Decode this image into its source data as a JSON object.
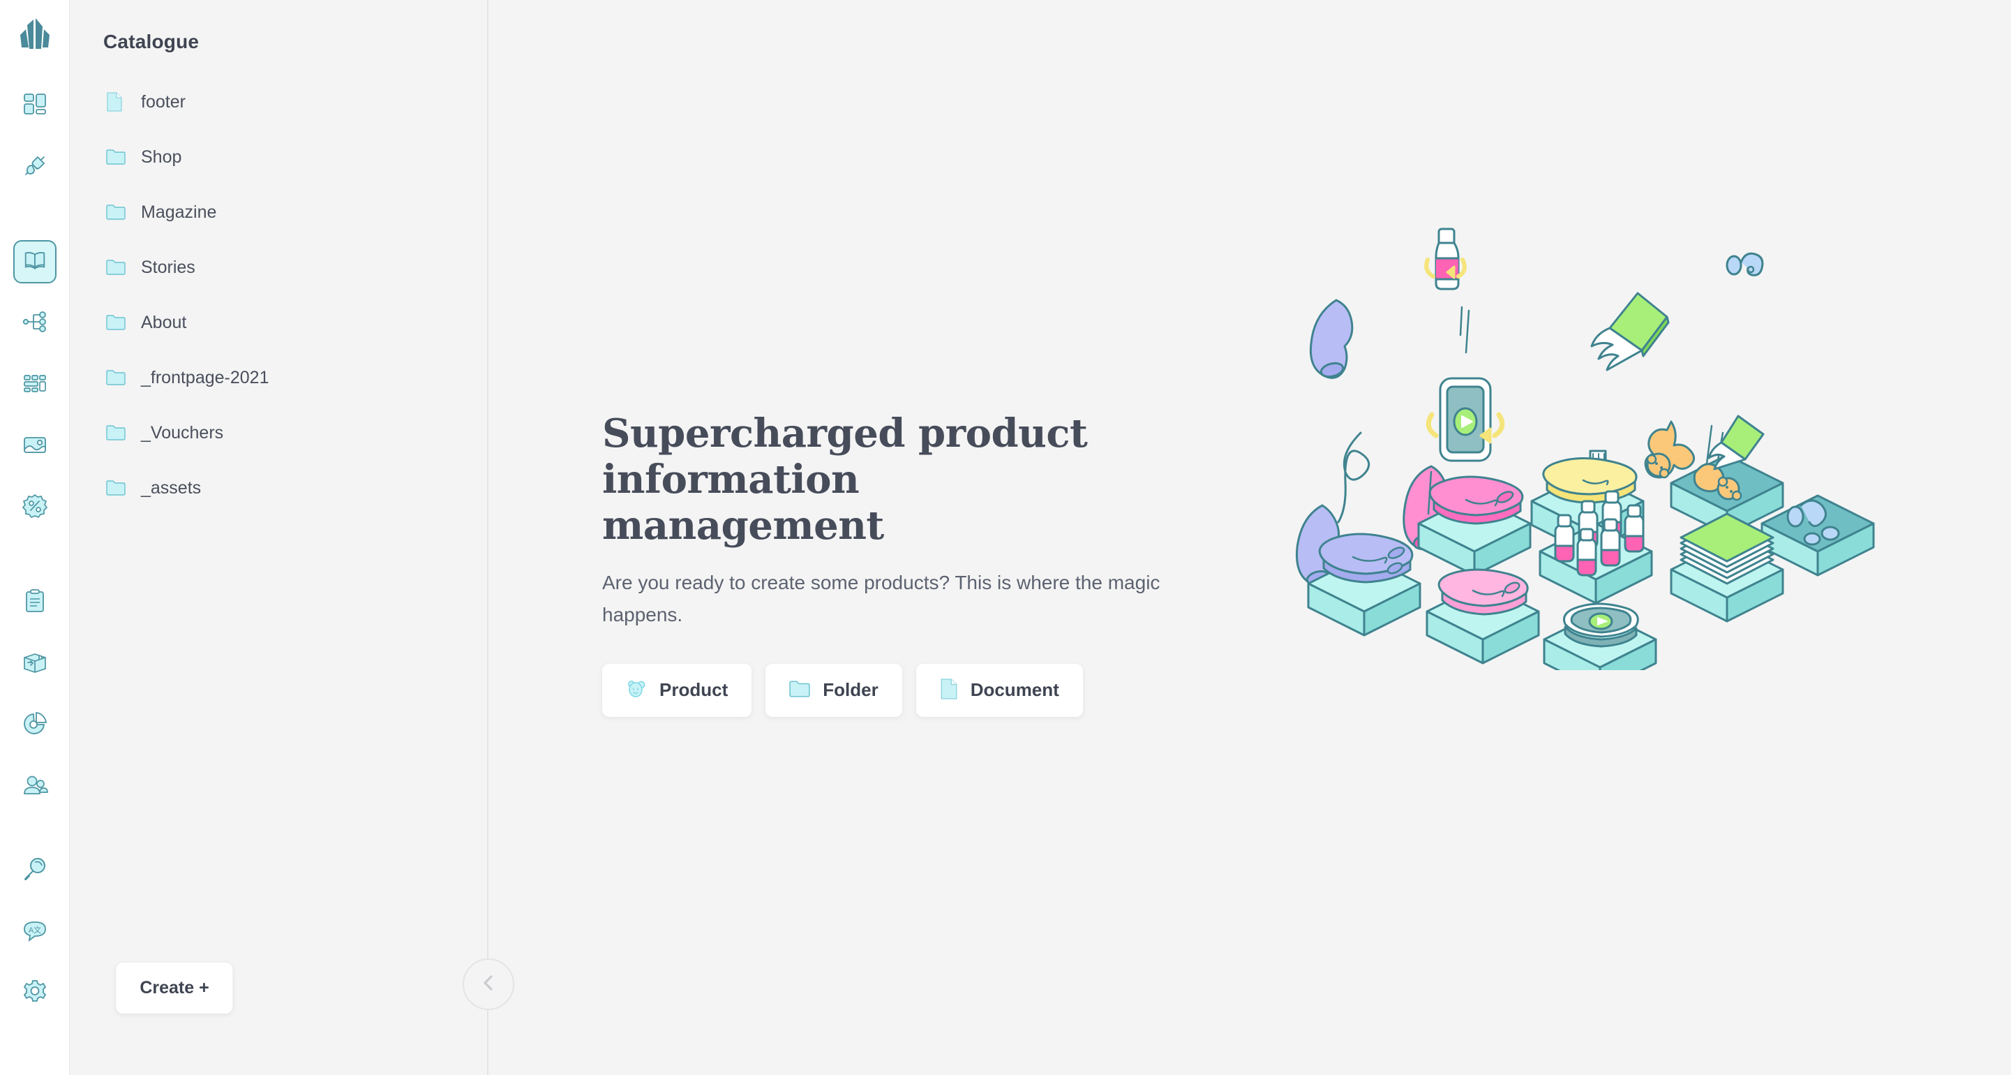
{
  "brand": {
    "logo_name": "crystal-logo"
  },
  "colors": {
    "page_bg": "#f4f4f4",
    "rail_bg": "#ffffff",
    "accent_teal": "#4e96a3",
    "icon_fill": "#c9f2f7",
    "active_bg": "#d6f6f7",
    "text_dark": "#3f4451",
    "text_body": "#5c6270",
    "divider": "#e3e4e6",
    "illus_box_top": "#bff5f0",
    "illus_box_side": "#5aa3ac",
    "illus_outline": "#3f838f",
    "illus_pink": "#ff63b4",
    "illus_pink_light": "#ffb3de",
    "illus_periwinkle": "#b8bdf5",
    "illus_green": "#a8ef7a",
    "illus_yellow": "#fbf0a0",
    "illus_orange": "#fbc87a",
    "illus_blue": "#b9d8f7"
  },
  "rail": {
    "items": [
      {
        "icon": "dashboard-tiles-icon",
        "name": "rail-item-dashboard",
        "active": false
      },
      {
        "icon": "plug-connector-icon",
        "name": "rail-item-connectors",
        "active": false
      },
      {
        "icon": "book-catalogue-icon",
        "name": "rail-item-catalogue",
        "active": true
      },
      {
        "icon": "sitemap-hierarchy-icon",
        "name": "rail-item-hierarchy",
        "active": false
      },
      {
        "icon": "grid-layout-icon",
        "name": "rail-item-layouts",
        "active": false
      },
      {
        "icon": "image-media-icon",
        "name": "rail-item-media",
        "active": false
      },
      {
        "icon": "discount-badge-icon",
        "name": "rail-item-discounts",
        "active": false
      },
      {
        "icon": "clipboard-orders-icon",
        "name": "rail-item-orders",
        "active": false
      },
      {
        "icon": "shipping-box-icon",
        "name": "rail-item-shipping",
        "active": false
      },
      {
        "icon": "pie-chart-icon",
        "name": "rail-item-analytics",
        "active": false
      },
      {
        "icon": "users-group-icon",
        "name": "rail-item-customers",
        "active": false
      },
      {
        "icon": "magnifier-search-icon",
        "name": "rail-item-search",
        "active": false
      },
      {
        "icon": "translate-language-icon",
        "name": "rail-item-language",
        "active": false
      },
      {
        "icon": "gear-settings-icon",
        "name": "rail-item-settings",
        "active": false
      }
    ]
  },
  "panel": {
    "title": "Catalogue",
    "items": [
      {
        "label": "footer",
        "icon": "document-icon"
      },
      {
        "label": "Shop",
        "icon": "folder-icon"
      },
      {
        "label": "Magazine",
        "icon": "folder-icon"
      },
      {
        "label": "Stories",
        "icon": "folder-icon"
      },
      {
        "label": "About",
        "icon": "folder-icon"
      },
      {
        "label": "_frontpage-2021",
        "icon": "folder-icon"
      },
      {
        "label": "_Vouchers",
        "icon": "folder-icon"
      },
      {
        "label": "_assets",
        "icon": "folder-icon"
      }
    ],
    "create_label": "Create +",
    "collapse_icon": "chevron-left-icon"
  },
  "hero": {
    "title_line1": "Supercharged product",
    "title_line2": "information management",
    "subtitle": "Are you ready to create some products? This is where the magic happens.",
    "actions": [
      {
        "label": "Product",
        "icon": "teddy-bear-icon"
      },
      {
        "label": "Folder",
        "icon": "folder-icon"
      },
      {
        "label": "Document",
        "icon": "document-icon"
      }
    ]
  },
  "illustration": {
    "name": "isometric-product-boxes-illustration",
    "description": "Falling products landing into isometric pallet boxes",
    "falling_items": [
      "pink-bottle",
      "blue-sock",
      "green-book",
      "phone-media-player",
      "periwinkle-sock",
      "pink-sock",
      "teddy-bear",
      "blue-earphones"
    ],
    "box_contents": [
      "folded-periwinkle-textile",
      "folded-pink-textile",
      "folded-lightpink-textile",
      "folded-yellow-textile",
      "pink-bottles-group",
      "green-book-stack",
      "teddy-bears",
      "media-player",
      "blue-earphones-group"
    ]
  }
}
